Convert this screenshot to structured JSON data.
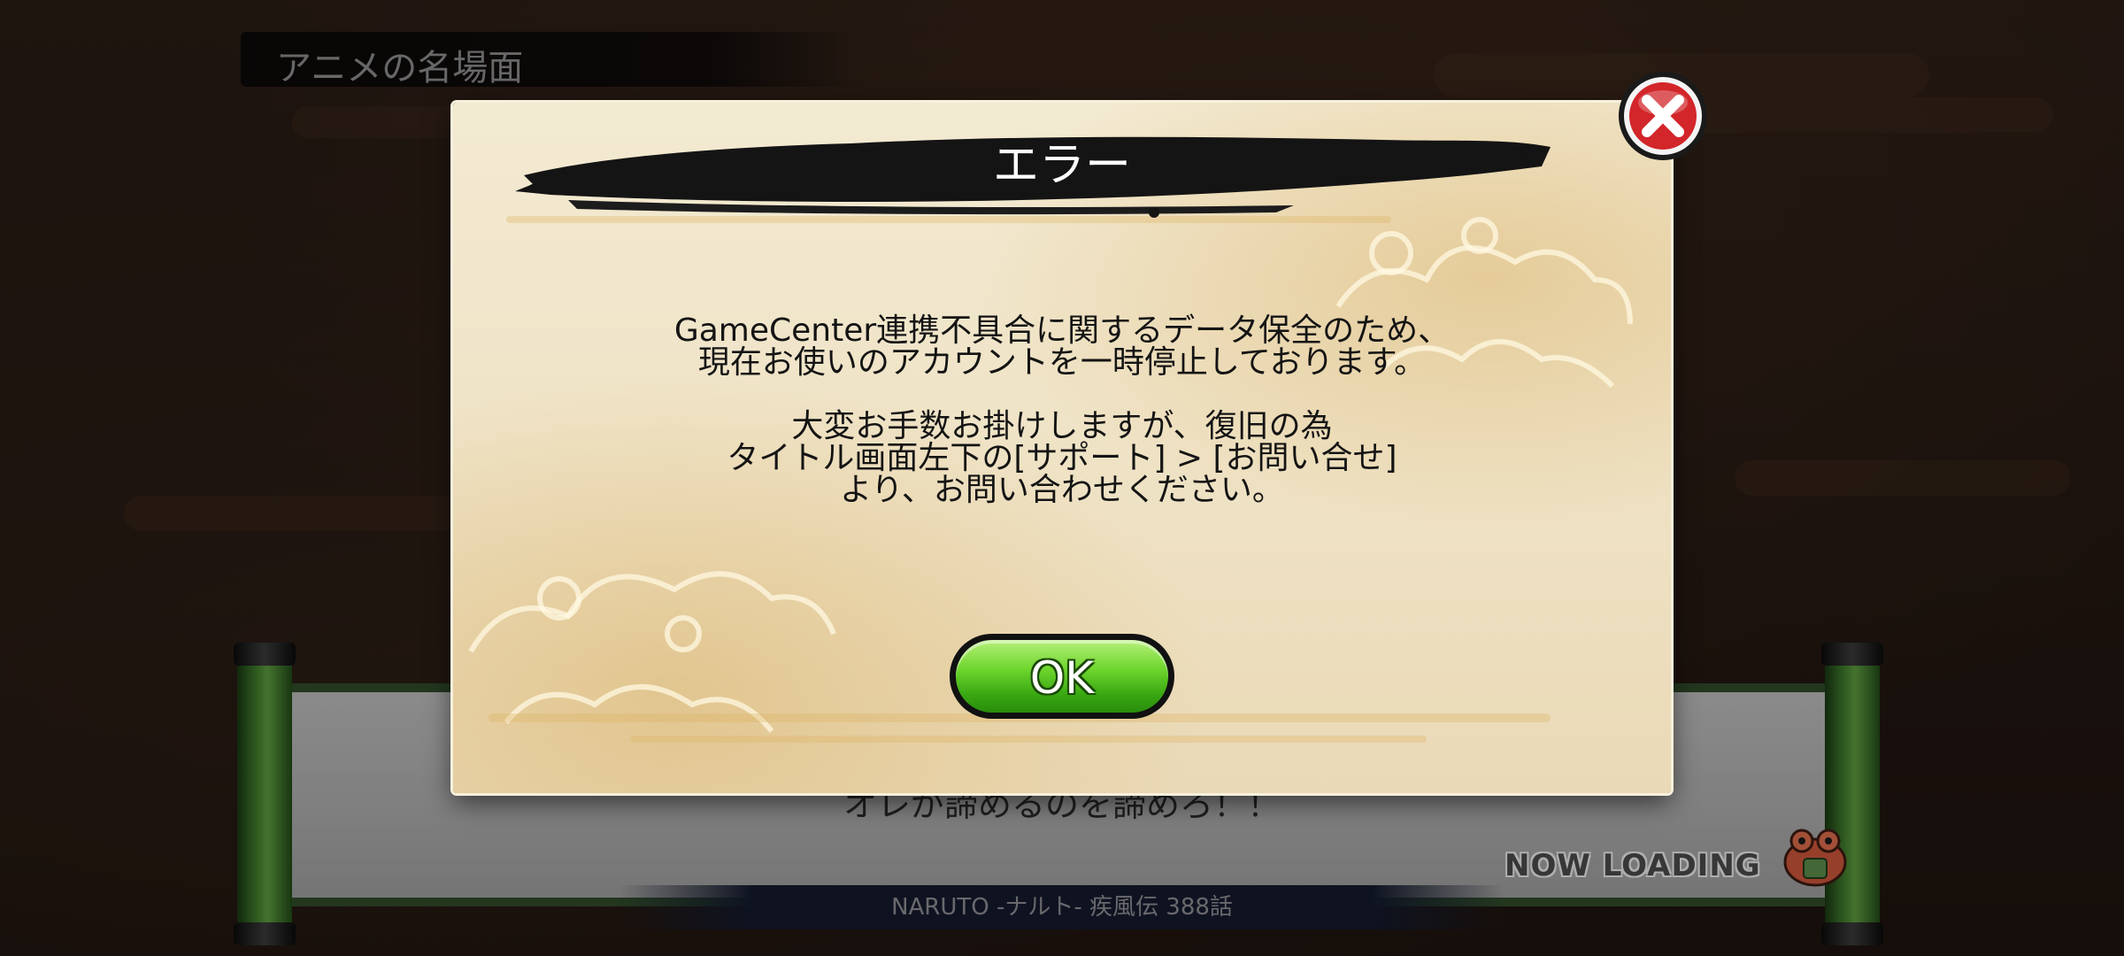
{
  "scene": {
    "title": "アニメの名場面",
    "quote": "オレが諦めるのを諦めろ！！",
    "episode": "NARUTO -ナルト- 疾風伝 388話",
    "loading_text": "NOW LOADING"
  },
  "dialog": {
    "title": "エラー",
    "message_lines": [
      "GameCenter連携不具合に関するデータ保全のため、",
      "現在お使いのアカウントを一時停止しております。",
      "大変お手数お掛けしますが、復旧の為",
      "タイトル画面左下の[サポート] > [お問い合せ]",
      "より、お問い合わせください。"
    ],
    "ok_label": "OK",
    "close_icon": "close-icon"
  },
  "colors": {
    "parchment": "#efe3c6",
    "ok_green": "#39a812",
    "close_red": "#d2262a",
    "scroll_rod_green": "#3f7a2c"
  }
}
